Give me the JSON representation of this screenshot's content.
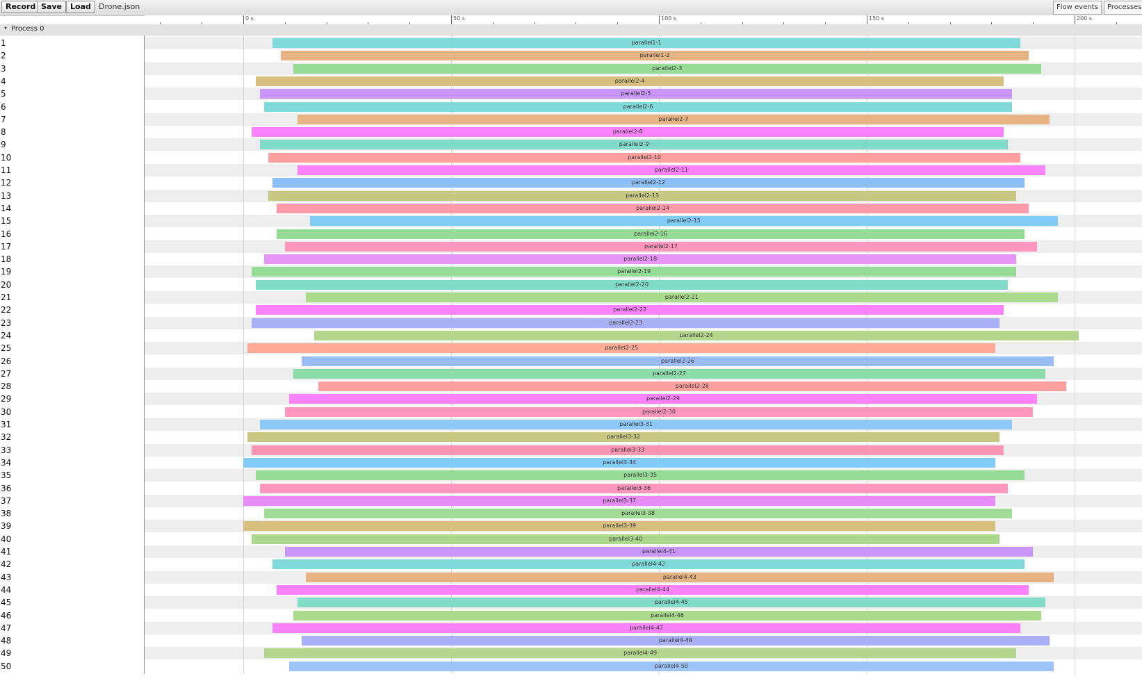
{
  "toolbar": {
    "record_label": "Record",
    "save_label": "Save",
    "load_label": "Load",
    "filename": "Drone.json",
    "flow_events_label": "Flow events",
    "processes_label": "Processes"
  },
  "ruler": {
    "ticks": [
      "0 s",
      "50 s",
      "100 s",
      "150 s",
      "200 s"
    ]
  },
  "process": {
    "caret": "▾",
    "label": "Process 0"
  },
  "threads": [
    {
      "row": "1",
      "name": "parallel1-1",
      "start": 7.0,
      "end": 187.0,
      "color": "#80dada"
    },
    {
      "row": "2",
      "name": "parallel1-2",
      "start": 9.0,
      "end": 189.0,
      "color": "#e6b482"
    },
    {
      "row": "3",
      "name": "parallel2-3",
      "start": 12.0,
      "end": 192.0,
      "color": "#96dc96"
    },
    {
      "row": "4",
      "name": "parallel2-4",
      "start": 3.0,
      "end": 183.0,
      "color": "#d8c080"
    },
    {
      "row": "5",
      "name": "parallel2-5",
      "start": 4.0,
      "end": 185.0,
      "color": "#c896f8"
    },
    {
      "row": "6",
      "name": "parallel2-6",
      "start": 5.0,
      "end": 185.0,
      "color": "#80dada"
    },
    {
      "row": "7",
      "name": "parallel2-7",
      "start": 13.0,
      "end": 194.0,
      "color": "#e6b482"
    },
    {
      "row": "8",
      "name": "parallel2-8",
      "start": 2.0,
      "end": 183.0,
      "color": "#fa82fa"
    },
    {
      "row": "9",
      "name": "parallel2-9",
      "start": 4.0,
      "end": 184.0,
      "color": "#80dcc8"
    },
    {
      "row": "10",
      "name": "parallel2-10",
      "start": 6.0,
      "end": 187.0,
      "color": "#ffa0a0"
    },
    {
      "row": "11",
      "name": "parallel2-11",
      "start": 13.0,
      "end": 193.0,
      "color": "#fa82fa"
    },
    {
      "row": "12",
      "name": "parallel2-12",
      "start": 7.0,
      "end": 188.0,
      "color": "#8cbef8"
    },
    {
      "row": "13",
      "name": "parallel2-13",
      "start": 6.0,
      "end": 186.0,
      "color": "#c8c882"
    },
    {
      "row": "14",
      "name": "parallel2-14",
      "start": 8.0,
      "end": 189.0,
      "color": "#ff9aaa"
    },
    {
      "row": "15",
      "name": "parallel2-15",
      "start": 16.0,
      "end": 196.0,
      "color": "#82ccfa"
    },
    {
      "row": "16",
      "name": "parallel2-16",
      "start": 8.0,
      "end": 188.0,
      "color": "#96dc96"
    },
    {
      "row": "17",
      "name": "parallel2-17",
      "start": 10.0,
      "end": 191.0,
      "color": "#ff96be"
    },
    {
      "row": "18",
      "name": "parallel2-18",
      "start": 5.0,
      "end": 186.0,
      "color": "#e696f6"
    },
    {
      "row": "19",
      "name": "parallel2-19",
      "start": 2.0,
      "end": 186.0,
      "color": "#96dc96"
    },
    {
      "row": "20",
      "name": "parallel2-20",
      "start": 3.0,
      "end": 184.0,
      "color": "#80dcc8"
    },
    {
      "row": "21",
      "name": "parallel2-21",
      "start": 15.0,
      "end": 196.0,
      "color": "#aada8c"
    },
    {
      "row": "22",
      "name": "parallel2-22",
      "start": 3.0,
      "end": 183.0,
      "color": "#fa82fa"
    },
    {
      "row": "23",
      "name": "parallel2-23",
      "start": 2.0,
      "end": 182.0,
      "color": "#aab0f8"
    },
    {
      "row": "24",
      "name": "parallel2-24",
      "start": 17.0,
      "end": 201.0,
      "color": "#b4d68c"
    },
    {
      "row": "25",
      "name": "parallel2-25",
      "start": 1.0,
      "end": 181.0,
      "color": "#ffaa96"
    },
    {
      "row": "26",
      "name": "parallel2-26",
      "start": 14.0,
      "end": 195.0,
      "color": "#9cbcf8"
    },
    {
      "row": "27",
      "name": "parallel2-27",
      "start": 12.0,
      "end": 193.0,
      "color": "#8cdcaa"
    },
    {
      "row": "28",
      "name": "parallel2-28",
      "start": 18.0,
      "end": 198.0,
      "color": "#ffa0a0"
    },
    {
      "row": "29",
      "name": "parallel2-29",
      "start": 11.0,
      "end": 191.0,
      "color": "#fa82fa"
    },
    {
      "row": "30",
      "name": "parallel2-30",
      "start": 10.0,
      "end": 190.0,
      "color": "#ff96be"
    },
    {
      "row": "31",
      "name": "parallel3-31",
      "start": 4.0,
      "end": 185.0,
      "color": "#8cc8f8"
    },
    {
      "row": "32",
      "name": "parallel3-32",
      "start": 1.0,
      "end": 182.0,
      "color": "#c8c882"
    },
    {
      "row": "33",
      "name": "parallel3-33",
      "start": 2.0,
      "end": 183.0,
      "color": "#ff96b4"
    },
    {
      "row": "34",
      "name": "parallel3-34",
      "start": 0.0,
      "end": 181.0,
      "color": "#82ccfa"
    },
    {
      "row": "35",
      "name": "parallel3-35",
      "start": 3.0,
      "end": 188.0,
      "color": "#96dc96"
    },
    {
      "row": "36",
      "name": "parallel3-36",
      "start": 4.0,
      "end": 184.0,
      "color": "#ff96be"
    },
    {
      "row": "37",
      "name": "parallel3-37",
      "start": 0.0,
      "end": 181.0,
      "color": "#e88cf8"
    },
    {
      "row": "38",
      "name": "parallel3-38",
      "start": 5.0,
      "end": 185.0,
      "color": "#a0dc96"
    },
    {
      "row": "39",
      "name": "parallel3-39",
      "start": 0.0,
      "end": 181.0,
      "color": "#d8c080"
    },
    {
      "row": "40",
      "name": "parallel3-40",
      "start": 2.0,
      "end": 182.0,
      "color": "#aad88c"
    },
    {
      "row": "41",
      "name": "parallel4-41",
      "start": 10.0,
      "end": 190.0,
      "color": "#c896f8"
    },
    {
      "row": "42",
      "name": "parallel4-42",
      "start": 7.0,
      "end": 188.0,
      "color": "#80dada"
    },
    {
      "row": "43",
      "name": "parallel4-43",
      "start": 15.0,
      "end": 195.0,
      "color": "#e6b482"
    },
    {
      "row": "44",
      "name": "parallel4-44",
      "start": 8.0,
      "end": 189.0,
      "color": "#fa82fa"
    },
    {
      "row": "45",
      "name": "parallel4-45",
      "start": 13.0,
      "end": 193.0,
      "color": "#80dcc8"
    },
    {
      "row": "46",
      "name": "parallel4-46",
      "start": 12.0,
      "end": 192.0,
      "color": "#aada8c"
    },
    {
      "row": "47",
      "name": "parallel4-47",
      "start": 7.0,
      "end": 187.0,
      "color": "#fa82fa"
    },
    {
      "row": "48",
      "name": "parallel4-48",
      "start": 14.0,
      "end": 194.0,
      "color": "#aab0f8"
    },
    {
      "row": "49",
      "name": "parallel4-49",
      "start": 5.0,
      "end": 186.0,
      "color": "#b4d68c"
    },
    {
      "row": "50",
      "name": "parallel4-50",
      "start": 11.0,
      "end": 195.0,
      "color": "#9cc4f8"
    }
  ]
}
